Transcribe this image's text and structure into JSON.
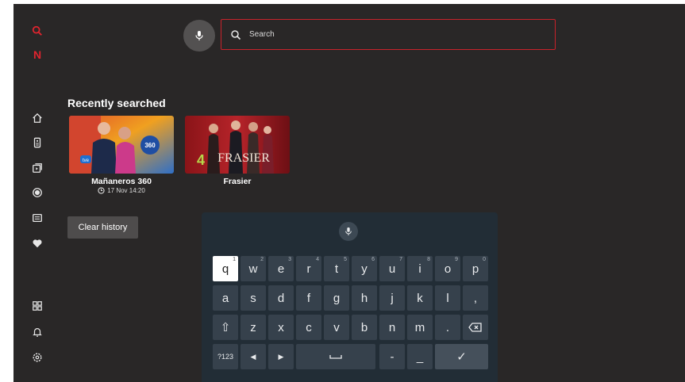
{
  "colors": {
    "accent": "#c9222b",
    "background": "#292727",
    "keyboard_bg": "#222d36",
    "key_bg": "#36414c"
  },
  "search": {
    "placeholder": "Search"
  },
  "recent": {
    "title": "Recently searched",
    "items": [
      {
        "title": "Mañaneros 360",
        "subtitle": "17 Nov 14:20",
        "channel_badge": "tve",
        "show_badge": "360"
      },
      {
        "title": "Frasier",
        "subtitle": "",
        "channel_badge": "4",
        "show_badge": "FRASIER"
      }
    ]
  },
  "clear_history": "Clear history",
  "sidebar": {
    "icons": [
      "search-icon",
      "netflix-logo-icon",
      "home-icon",
      "remote-icon",
      "apps-icon",
      "record-icon",
      "guide-icon",
      "favorites-icon",
      "grid-icon",
      "bell-icon",
      "settings-icon"
    ],
    "logo_letter": "N"
  },
  "keyboard": {
    "row1": [
      {
        "k": "q",
        "n": "1"
      },
      {
        "k": "w",
        "n": "2"
      },
      {
        "k": "e",
        "n": "3"
      },
      {
        "k": "r",
        "n": "4"
      },
      {
        "k": "t",
        "n": "5"
      },
      {
        "k": "y",
        "n": "6"
      },
      {
        "k": "u",
        "n": "7"
      },
      {
        "k": "i",
        "n": "8"
      },
      {
        "k": "o",
        "n": "9"
      },
      {
        "k": "p",
        "n": "0"
      }
    ],
    "row2": [
      "a",
      "s",
      "d",
      "f",
      "g",
      "h",
      "j",
      "k",
      "l",
      ","
    ],
    "row3": [
      "z",
      "x",
      "c",
      "v",
      "b",
      "n",
      "m",
      "."
    ],
    "numbers_label": "?123",
    "left_arrow": "◀",
    "right_arrow": "▶",
    "dash": "-",
    "underscore": "_",
    "shift": "⇧",
    "done": "✓"
  }
}
